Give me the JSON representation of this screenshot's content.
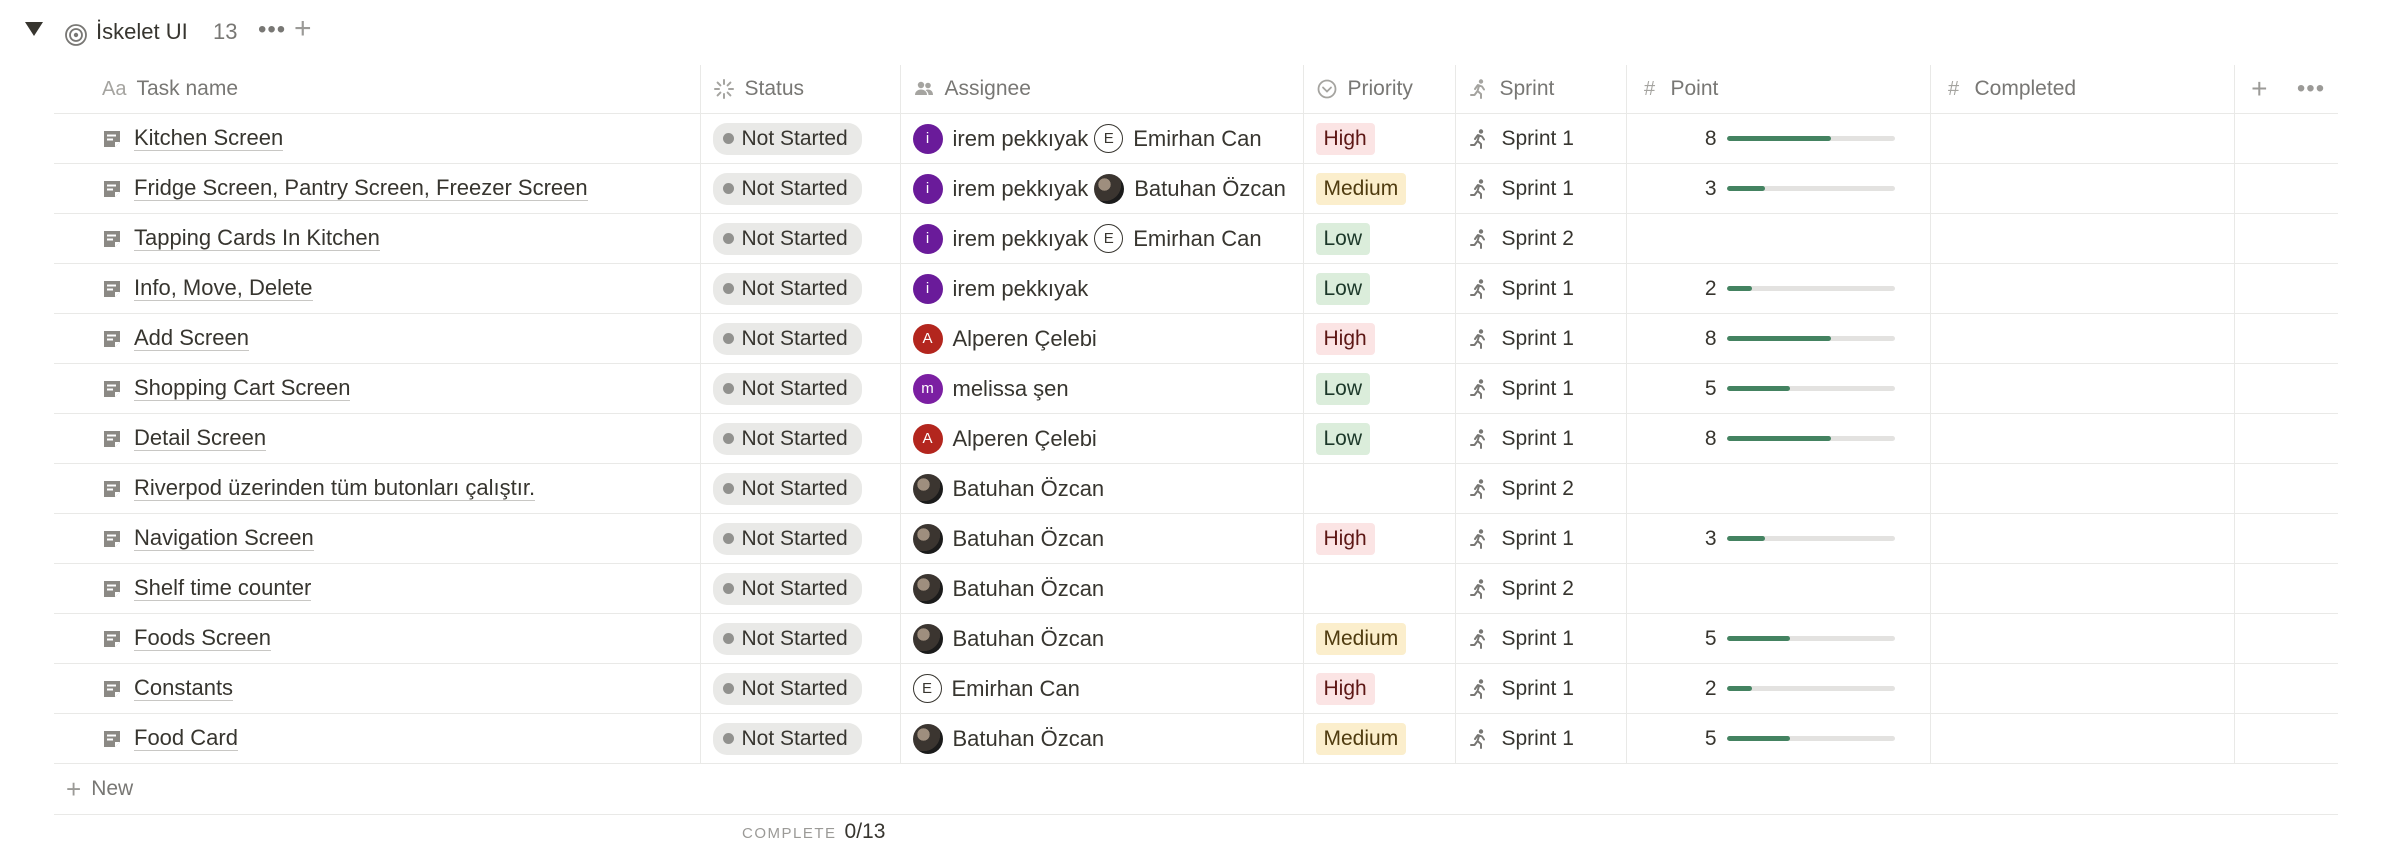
{
  "group": {
    "title": "İskelet UI",
    "count": "13",
    "add": "+",
    "more": "•••"
  },
  "columns": {
    "task_name": "Task name",
    "task_prefix": "Aa",
    "status": "Status",
    "assignee": "Assignee",
    "priority": "Priority",
    "sprint": "Sprint",
    "point": "Point",
    "completed": "Completed",
    "point_icon": "#",
    "completed_icon": "#",
    "add": "+",
    "more": "•••"
  },
  "rows": [
    {
      "name": "Kitchen Screen",
      "status": "Not Started",
      "assignees": [
        {
          "name": "irem pekkıyak",
          "initial": "i",
          "style": "i"
        },
        {
          "name": "Emirhan Can",
          "initial": "E",
          "style": "e"
        }
      ],
      "priority": "High",
      "priority_level": "high",
      "sprint": "Sprint 1",
      "point": "8",
      "progress": 0.62
    },
    {
      "name": "Fridge Screen, Pantry Screen, Freezer Screen",
      "status": "Not Started",
      "assignees": [
        {
          "name": "irem pekkıyak",
          "initial": "i",
          "style": "i"
        },
        {
          "name": "Batuhan Özcan",
          "initial": "",
          "style": "photo"
        }
      ],
      "priority": "Medium",
      "priority_level": "medium",
      "sprint": "Sprint 1",
      "point": "3",
      "progress": 0.23
    },
    {
      "name": "Tapping Cards In Kitchen",
      "status": "Not Started",
      "assignees": [
        {
          "name": "irem pekkıyak",
          "initial": "i",
          "style": "i"
        },
        {
          "name": "Emirhan Can",
          "initial": "E",
          "style": "e"
        }
      ],
      "priority": "Low",
      "priority_level": "low",
      "sprint": "Sprint 2",
      "point": "",
      "progress": null
    },
    {
      "name": "Info, Move, Delete",
      "status": "Not Started",
      "assignees": [
        {
          "name": "irem pekkıyak",
          "initial": "i",
          "style": "i"
        }
      ],
      "priority": "Low",
      "priority_level": "low",
      "sprint": "Sprint 1",
      "point": "2",
      "progress": 0.15
    },
    {
      "name": "Add Screen",
      "status": "Not Started",
      "assignees": [
        {
          "name": "Alperen Çelebi",
          "initial": "A",
          "style": "a"
        }
      ],
      "priority": "High",
      "priority_level": "high",
      "sprint": "Sprint 1",
      "point": "8",
      "progress": 0.62
    },
    {
      "name": "Shopping Cart Screen",
      "status": "Not Started",
      "assignees": [
        {
          "name": "melissa şen",
          "initial": "m",
          "style": "m"
        }
      ],
      "priority": "Low",
      "priority_level": "low",
      "sprint": "Sprint 1",
      "point": "5",
      "progress": 0.38
    },
    {
      "name": "Detail Screen",
      "status": "Not Started",
      "assignees": [
        {
          "name": "Alperen Çelebi",
          "initial": "A",
          "style": "a"
        }
      ],
      "priority": "Low",
      "priority_level": "low",
      "sprint": "Sprint 1",
      "point": "8",
      "progress": 0.62
    },
    {
      "name": "Riverpod üzerinden tüm butonları çalıştır.",
      "status": "Not Started",
      "assignees": [
        {
          "name": "Batuhan Özcan",
          "initial": "",
          "style": "photo"
        }
      ],
      "priority": "",
      "priority_level": "",
      "sprint": "Sprint 2",
      "point": "",
      "progress": null
    },
    {
      "name": "Navigation Screen",
      "status": "Not Started",
      "assignees": [
        {
          "name": "Batuhan Özcan",
          "initial": "",
          "style": "photo"
        }
      ],
      "priority": "High",
      "priority_level": "high",
      "sprint": "Sprint 1",
      "point": "3",
      "progress": 0.23
    },
    {
      "name": "Shelf time counter",
      "status": "Not Started",
      "assignees": [
        {
          "name": "Batuhan Özcan",
          "initial": "",
          "style": "photo"
        }
      ],
      "priority": "",
      "priority_level": "",
      "sprint": "Sprint 2",
      "point": "",
      "progress": null
    },
    {
      "name": "Foods Screen",
      "status": "Not Started",
      "assignees": [
        {
          "name": "Batuhan Özcan",
          "initial": "",
          "style": "photo"
        }
      ],
      "priority": "Medium",
      "priority_level": "medium",
      "sprint": "Sprint 1",
      "point": "5",
      "progress": 0.38
    },
    {
      "name": "Constants",
      "status": "Not Started",
      "assignees": [
        {
          "name": "Emirhan Can",
          "initial": "E",
          "style": "e"
        }
      ],
      "priority": "High",
      "priority_level": "high",
      "sprint": "Sprint 1",
      "point": "2",
      "progress": 0.15
    },
    {
      "name": "Food Card",
      "status": "Not Started",
      "assignees": [
        {
          "name": "Batuhan Özcan",
          "initial": "",
          "style": "photo"
        }
      ],
      "priority": "Medium",
      "priority_level": "medium",
      "sprint": "Sprint 1",
      "point": "5",
      "progress": 0.38
    }
  ],
  "new_row": {
    "plus": "+",
    "label": "New"
  },
  "summary": {
    "label": "COMPLETE",
    "value": "0/13"
  },
  "colors": {
    "progress": "#448361",
    "status_dot": "#91918e",
    "high_bg": "#fbe4e4",
    "medium_bg": "#fbeecc",
    "low_bg": "#dbeddb"
  },
  "icons": {
    "group": "target-icon",
    "page": "page-icon",
    "sprint": "running-person-icon",
    "status": "loading-spinner-icon",
    "assignee": "people-icon",
    "priority": "chevron-circle-icon"
  }
}
